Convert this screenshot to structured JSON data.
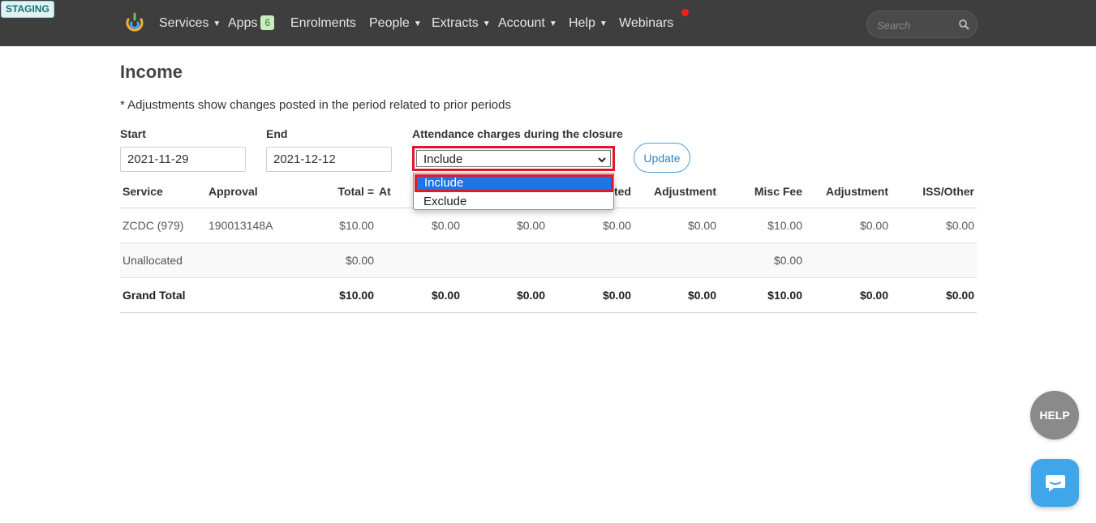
{
  "env_badge": "STAGING",
  "nav": {
    "items": [
      {
        "label": "Services",
        "has_caret": true
      },
      {
        "label": "Apps",
        "badge": "6"
      },
      {
        "label": "Enrolments"
      },
      {
        "label": "People",
        "has_caret": true
      },
      {
        "label": "Extracts",
        "has_caret": true
      },
      {
        "label": "Account",
        "has_caret": true
      },
      {
        "label": "Help",
        "has_caret": true
      },
      {
        "label": "Webinars",
        "notification_dot": true
      }
    ],
    "search": {
      "placeholder": "Search",
      "icon": "search-icon"
    }
  },
  "page": {
    "title": "Income",
    "note": "* Adjustments show changes posted in the period related to prior periods"
  },
  "filters": {
    "start": {
      "label": "Start",
      "value": "2021-11-29"
    },
    "end": {
      "label": "End",
      "value": "2021-12-12"
    },
    "attendance": {
      "label": "Attendance charges during the closure",
      "selected": "Include",
      "options": [
        "Include",
        "Exclude"
      ]
    },
    "update_label": "Update"
  },
  "table": {
    "headers": [
      "Service",
      "Approval",
      "Total =",
      "At",
      "",
      "ted",
      "Adjustment",
      "Misc Fee",
      "Adjustment",
      "ISS/Other"
    ],
    "rows": [
      [
        "ZCDC (979)",
        "190013148A",
        "$10.00",
        "$0.00",
        "$0.00",
        "$0.00",
        "$0.00",
        "$10.00",
        "$0.00",
        "$0.00"
      ],
      [
        "Unallocated",
        "",
        "$0.00",
        "",
        "",
        "",
        "",
        "$0.00",
        "",
        ""
      ],
      [
        "Grand Total",
        "",
        "$10.00",
        "$0.00",
        "$0.00",
        "$0.00",
        "$0.00",
        "$10.00",
        "$0.00",
        "$0.00"
      ]
    ]
  },
  "floating": {
    "help_label": "HELP",
    "chat_icon": "chat-icon"
  },
  "colors": {
    "navbar": "#3e3e3e",
    "highlight_outline": "#e11a2b",
    "selected_option": "#1e74e8",
    "accent": "#2a86c8",
    "notification": "#ff1a1a"
  }
}
